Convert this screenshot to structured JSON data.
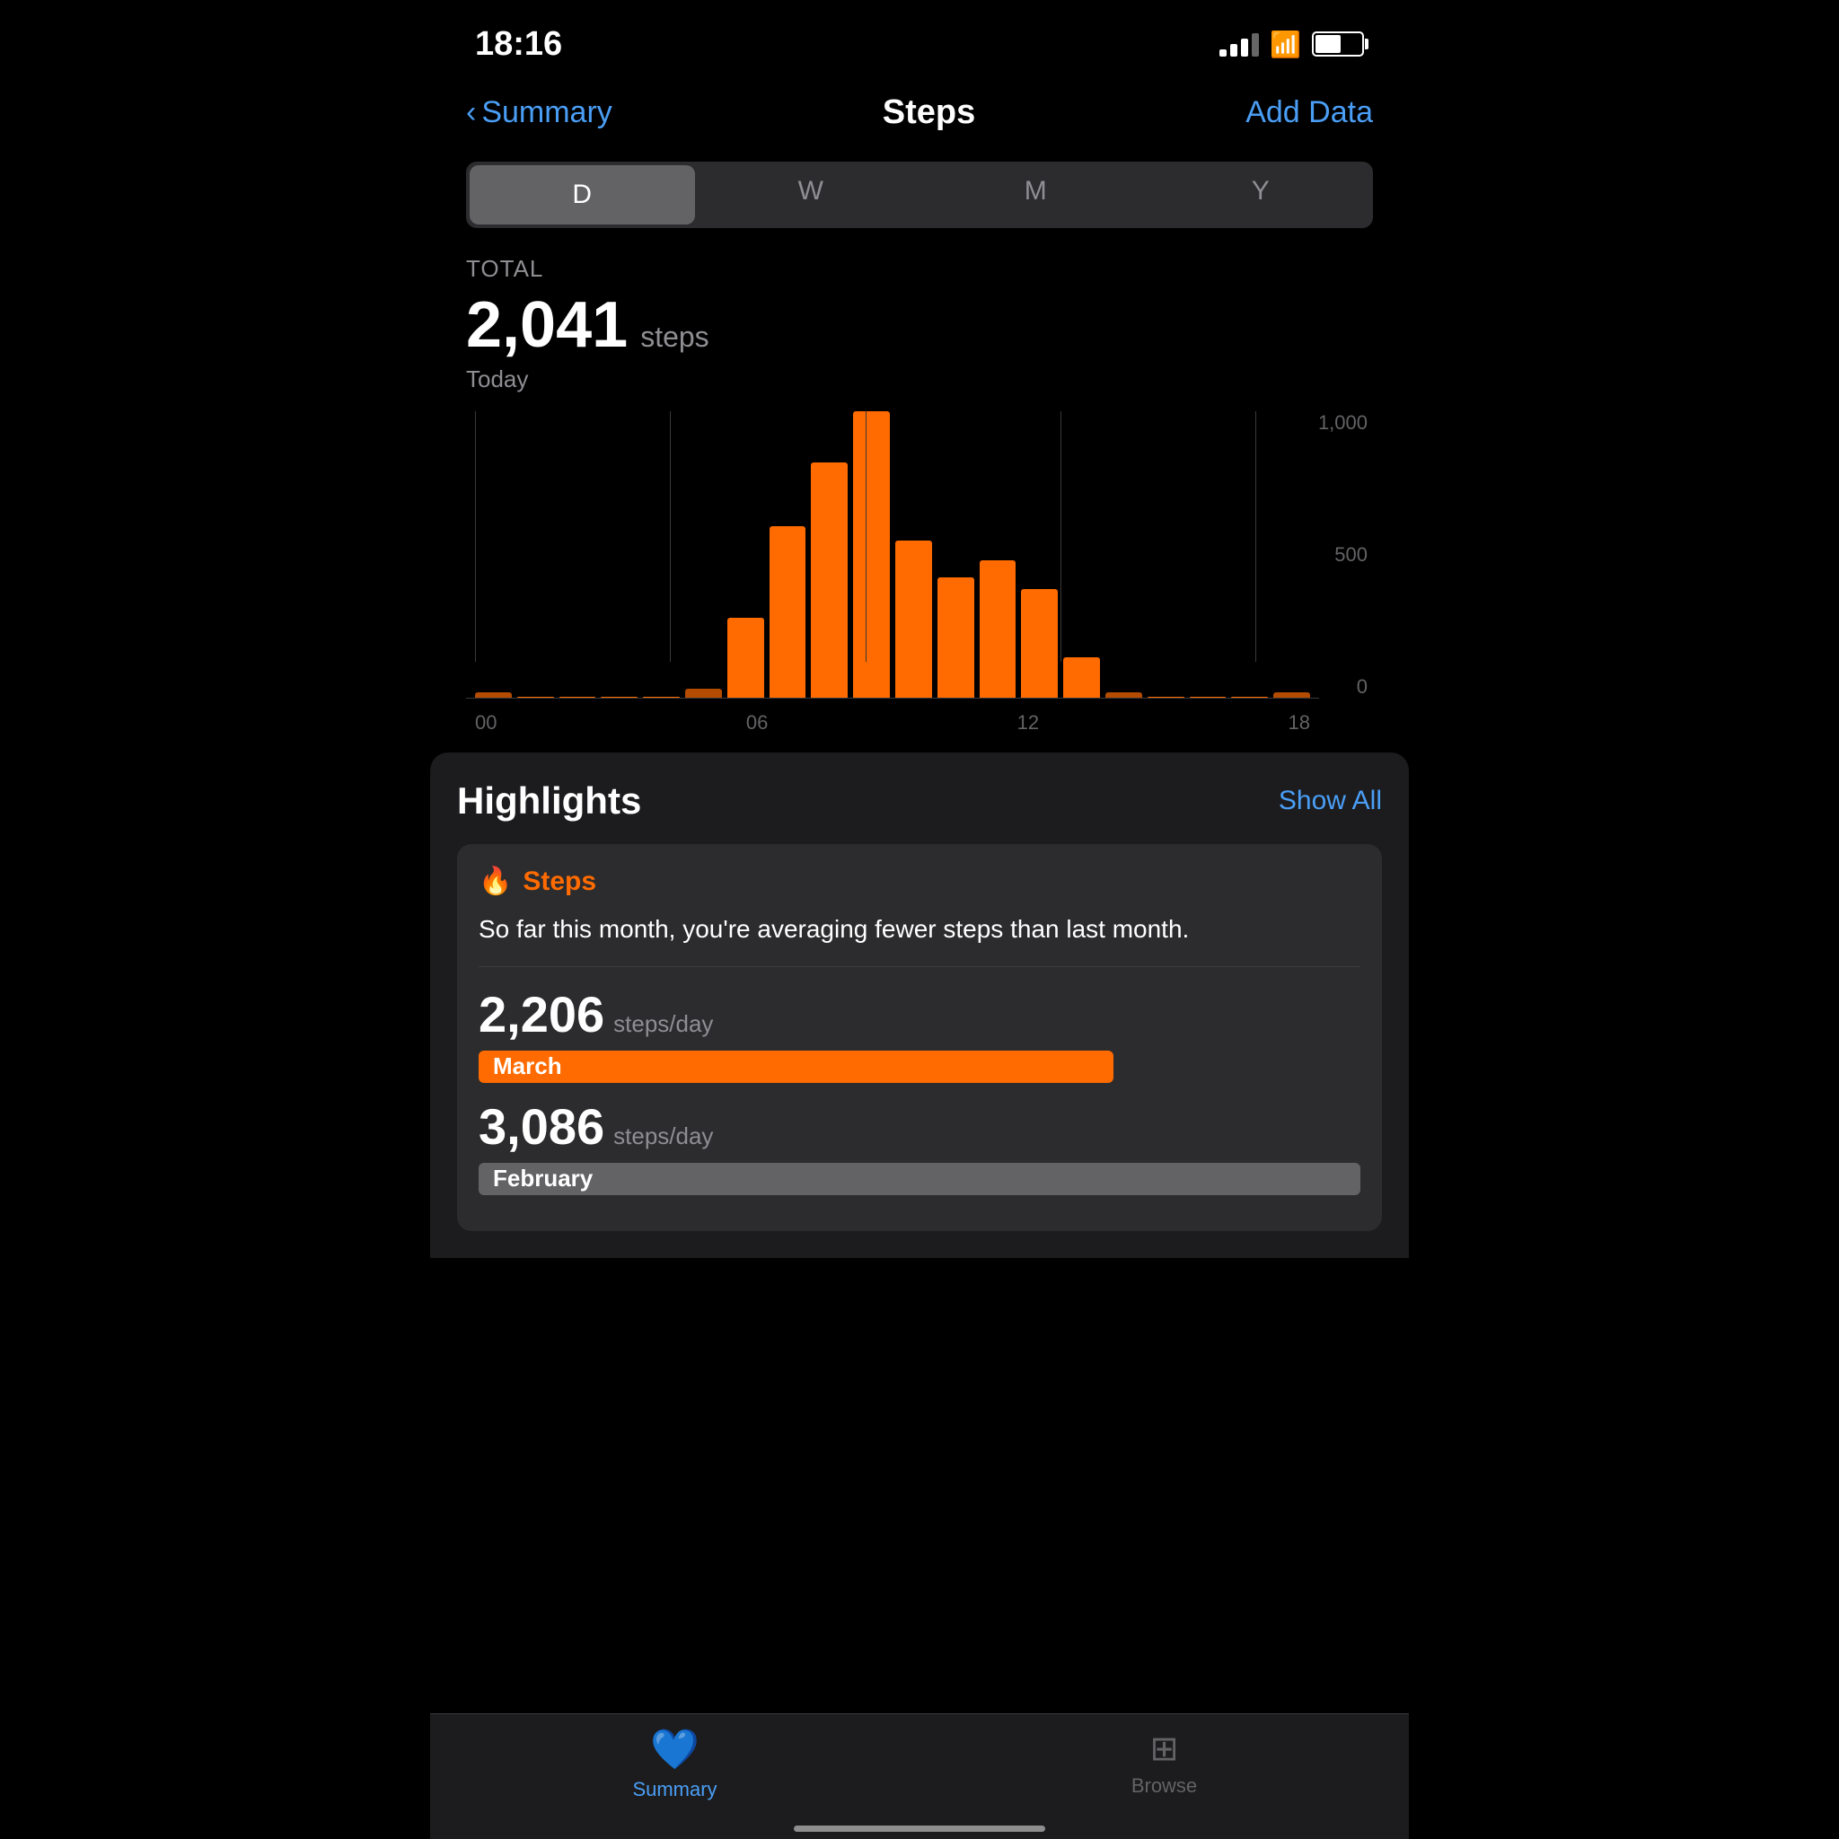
{
  "statusBar": {
    "time": "18:16",
    "signalBars": [
      10,
      16,
      22,
      28
    ],
    "batteryLevel": 55
  },
  "nav": {
    "backLabel": "Summary",
    "title": "Steps",
    "addLabel": "Add Data"
  },
  "tabs": [
    {
      "id": "D",
      "label": "D",
      "active": true
    },
    {
      "id": "W",
      "label": "W",
      "active": false
    },
    {
      "id": "M",
      "label": "M",
      "active": false
    },
    {
      "id": "Y",
      "label": "Y",
      "active": false
    }
  ],
  "total": {
    "label": "TOTAL",
    "number": "2,041",
    "unit": "steps",
    "date": "Today"
  },
  "chart": {
    "yLabels": [
      "1,000",
      "500",
      "0"
    ],
    "xLabels": [
      "00",
      "06",
      "12",
      "18"
    ],
    "bars": [
      {
        "height": 2,
        "tiny": true
      },
      {
        "height": 0
      },
      {
        "height": 0
      },
      {
        "height": 0
      },
      {
        "height": 0
      },
      {
        "height": 3,
        "tiny": true
      },
      {
        "height": 28
      },
      {
        "height": 60
      },
      {
        "height": 82
      },
      {
        "height": 100
      },
      {
        "height": 55
      },
      {
        "height": 42
      },
      {
        "height": 48
      },
      {
        "height": 38
      },
      {
        "height": 14
      },
      {
        "height": 2,
        "tiny": true
      },
      {
        "height": 0
      },
      {
        "height": 0
      },
      {
        "height": 0
      },
      {
        "height": 2,
        "tiny": true
      }
    ]
  },
  "highlights": {
    "title": "Highlights",
    "showAllLabel": "Show All",
    "card": {
      "icon": "🔥",
      "label": "Steps",
      "description": "So far this month, you're averaging fewer steps than last month.",
      "stats": [
        {
          "number": "2,206",
          "unit": "steps/day",
          "barLabel": "March",
          "barColor": "orange",
          "barWidth": 72
        },
        {
          "number": "3,086",
          "unit": "steps/day",
          "barLabel": "February",
          "barColor": "gray",
          "barWidth": 100
        }
      ]
    }
  },
  "bottomNav": [
    {
      "id": "summary",
      "icon": "💙",
      "label": "Summary",
      "active": true
    },
    {
      "id": "browse",
      "icon": "⊞",
      "label": "Browse",
      "active": false
    }
  ]
}
